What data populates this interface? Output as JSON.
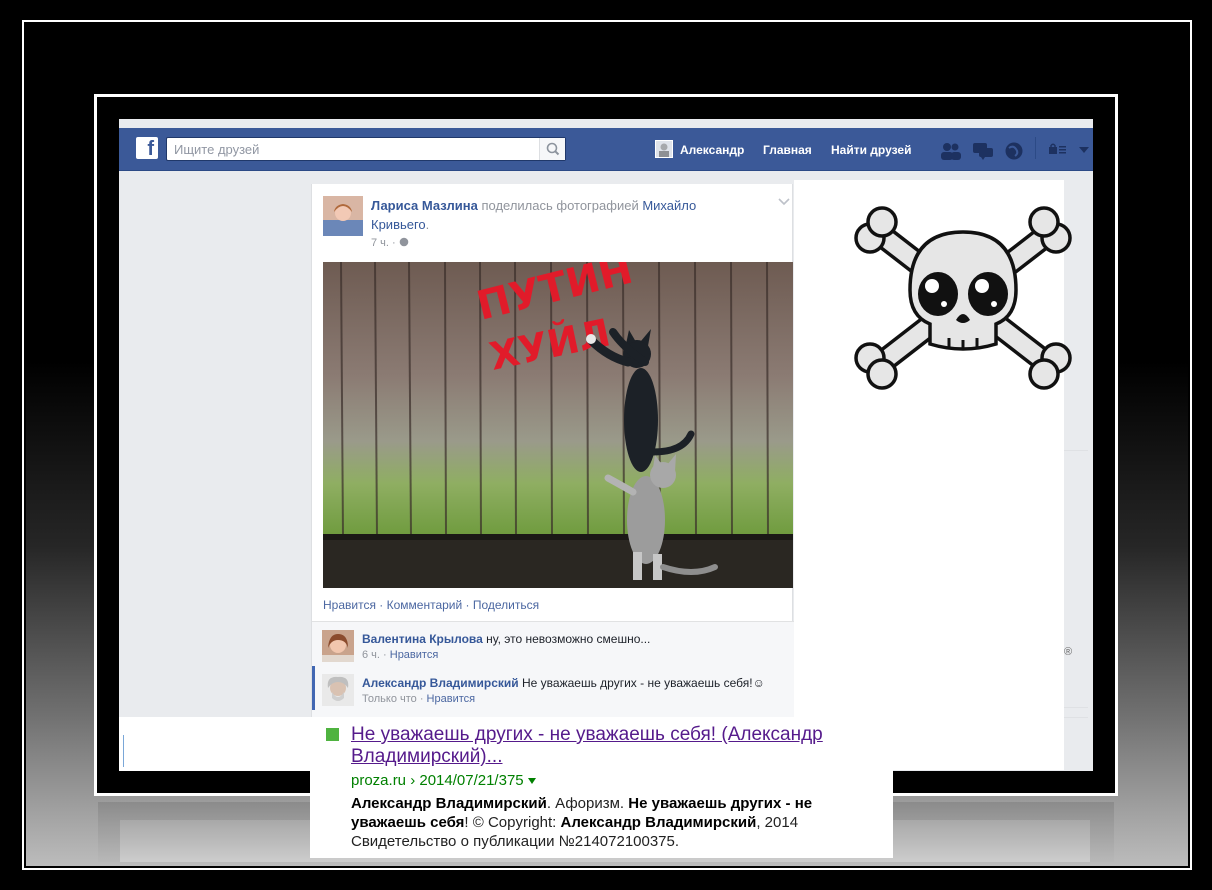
{
  "topbar": {
    "search_placeholder": "Ищите друзей",
    "user_name": "Александр",
    "home": "Главная",
    "find_friends": "Найти друзей",
    "brand_color": "#3b5998"
  },
  "post": {
    "author": "Лариса Мазлина",
    "action": "поделилась фотографией",
    "source": "Михайло Кривьего",
    "time": "7 ч.",
    "photo_text": "ПУТИН ХУЙЛО",
    "actions": "Нравится · Комментарий · Поделиться"
  },
  "comments": [
    {
      "name": "Валентина Крылова",
      "text": "ну, это невозможно смешно...",
      "time": "6 ч.",
      "like": "Нравится"
    },
    {
      "name": "Александр Владимирский",
      "text": "Не уважаешь других - не уважаешь себя!☺",
      "time": "Только что",
      "like": "Нравится"
    }
  ],
  "right": {
    "mark": "®"
  },
  "snippet": {
    "title": "Не уважаешь других - не уважаешь себя! (Александр Владимирский)...",
    "url": "proza.ru › 2014/07/21/375",
    "text_author": "Александр Владимирский",
    "text_1": ". Афоризм. ",
    "text_bold": "Не уважаешь других - не уважаешь себя",
    "text_2": "! © Copyright: ",
    "text_year": ", 2014",
    "text_3": "Свидетельство о публикации №214072100375."
  }
}
